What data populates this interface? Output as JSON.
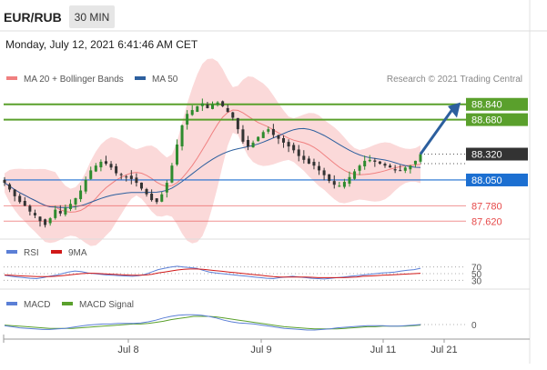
{
  "header": {
    "symbol": "EUR/RUB",
    "timeframe": "30 MIN",
    "datetime": "Monday, July 12, 2021 6:41:46 AM CET",
    "credit": "Research © 2021 Trading Central"
  },
  "colors": {
    "ma20": "#f08080",
    "ma50": "#2c5f9e",
    "bands_fill": "#fbd9d9",
    "resistance": "#5aa02c",
    "pivot": "#1c6fd1",
    "support": "#e64a4a",
    "last_price_bg": "#333333",
    "arrow": "#2c5f9e",
    "rsi": "#5b7fd6",
    "rsi_ma": "#d01818",
    "macd": "#5b7fd6",
    "macd_signal": "#5aa02c",
    "candle_up": "#2e8b2e",
    "candle_down": "#333333"
  },
  "chart_data": [
    {
      "type": "candlestick",
      "legend": [
        {
          "name": "MA 20 + Bollinger Bands",
          "color": "#f08080"
        },
        {
          "name": "MA 50",
          "color": "#2c5f9e"
        }
      ],
      "x_ticks": [
        "Jul 8",
        "Jul 9",
        "Jul 11",
        "Jul 21"
      ],
      "ylim": [
        87.48,
        88.98
      ],
      "levels": [
        {
          "label": "88.840",
          "value": 88.84,
          "kind": "resistance"
        },
        {
          "label": "88.680",
          "value": 88.68,
          "kind": "resistance"
        },
        {
          "label": "88.320",
          "value": 88.32,
          "kind": "last"
        },
        {
          "label": "88.050",
          "value": 88.05,
          "kind": "pivot"
        },
        {
          "label": "87.780",
          "value": 87.78,
          "kind": "support"
        },
        {
          "label": "87.620",
          "value": 87.62,
          "kind": "support"
        }
      ],
      "close": [
        88.02,
        87.95,
        87.88,
        87.82,
        87.78,
        87.72,
        87.68,
        87.62,
        87.58,
        87.65,
        87.74,
        87.7,
        87.76,
        87.8,
        87.86,
        87.94,
        88.05,
        88.15,
        88.2,
        88.24,
        88.22,
        88.18,
        88.12,
        88.1,
        88.08,
        88.06,
        88.02,
        87.96,
        87.9,
        87.84,
        87.82,
        87.9,
        88.02,
        88.2,
        88.42,
        88.62,
        88.74,
        88.78,
        88.82,
        88.85,
        88.8,
        88.84,
        88.86,
        88.82,
        88.76,
        88.7,
        88.58,
        88.45,
        88.4,
        88.44,
        88.5,
        88.55,
        88.58,
        88.52,
        88.48,
        88.44,
        88.4,
        88.36,
        88.3,
        88.26,
        88.22,
        88.2,
        88.15,
        88.1,
        88.04,
        88.0,
        87.99,
        88.03,
        88.08,
        88.14,
        88.2,
        88.25,
        88.26,
        88.24,
        88.22,
        88.2,
        88.18,
        88.15,
        88.15,
        88.18,
        88.2,
        88.25,
        88.32
      ],
      "volatility": 0.06
    },
    {
      "type": "line",
      "name": "RSI",
      "legend": [
        {
          "name": "RSI",
          "color": "#5b7fd6"
        },
        {
          "name": "9MA",
          "color": "#d01818"
        }
      ],
      "y_ticks": [
        "70",
        "50",
        "30"
      ],
      "ylim": [
        20,
        80
      ],
      "rsi": [
        45,
        42,
        40,
        38,
        36,
        35,
        38,
        42,
        45,
        50,
        55,
        58,
        56,
        52,
        50,
        48,
        46,
        45,
        44,
        43,
        42,
        44,
        48,
        55,
        62,
        66,
        70,
        72,
        70,
        68,
        66,
        60,
        55,
        52,
        50,
        48,
        46,
        44,
        42,
        40,
        38,
        36,
        35,
        38,
        40,
        42,
        40,
        38,
        36,
        35,
        34,
        36,
        38,
        40,
        42,
        44,
        46,
        48,
        50,
        52,
        53,
        55,
        58,
        60,
        62,
        66
      ],
      "rsi_ma": [
        46,
        45,
        44,
        43,
        42,
        41,
        41,
        41,
        42,
        44,
        46,
        48,
        50,
        51,
        51,
        50,
        49,
        48,
        47,
        46,
        45,
        45,
        46,
        48,
        52,
        55,
        58,
        61,
        63,
        64,
        64,
        63,
        61,
        59,
        57,
        55,
        53,
        51,
        49,
        47,
        45,
        43,
        41,
        40,
        40,
        40,
        40,
        40,
        39,
        38,
        38,
        38,
        38,
        38,
        39,
        40,
        42,
        43,
        44,
        45,
        46,
        47,
        48,
        49,
        50,
        51
      ]
    },
    {
      "type": "line",
      "name": "MACD",
      "legend": [
        {
          "name": "MACD",
          "color": "#5b7fd6"
        },
        {
          "name": "MACD Signal",
          "color": "#5aa02c"
        }
      ],
      "y_ticks": [
        "0"
      ],
      "ylim": [
        -0.25,
        0.25
      ],
      "macd": [
        -0.02,
        -0.04,
        -0.06,
        -0.07,
        -0.08,
        -0.09,
        -0.09,
        -0.08,
        -0.07,
        -0.05,
        -0.03,
        -0.01,
        0.0,
        0.01,
        0.01,
        0.02,
        0.02,
        0.02,
        0.03,
        0.05,
        0.08,
        0.12,
        0.15,
        0.17,
        0.18,
        0.18,
        0.17,
        0.15,
        0.12,
        0.08,
        0.05,
        0.03,
        0.02,
        0.01,
        -0.01,
        -0.03,
        -0.05,
        -0.07,
        -0.08,
        -0.09,
        -0.1,
        -0.1,
        -0.09,
        -0.08,
        -0.06,
        -0.05,
        -0.04,
        -0.03,
        -0.02,
        -0.02,
        -0.02,
        -0.03,
        -0.03,
        -0.02,
        -0.01,
        0.0
      ],
      "signal": [
        -0.01,
        -0.02,
        -0.03,
        -0.04,
        -0.05,
        -0.06,
        -0.07,
        -0.07,
        -0.07,
        -0.07,
        -0.06,
        -0.05,
        -0.04,
        -0.03,
        -0.02,
        -0.01,
        0.0,
        0.01,
        0.01,
        0.02,
        0.04,
        0.06,
        0.09,
        0.11,
        0.13,
        0.15,
        0.15,
        0.15,
        0.14,
        0.12,
        0.1,
        0.08,
        0.06,
        0.04,
        0.02,
        0.0,
        -0.02,
        -0.04,
        -0.05,
        -0.06,
        -0.07,
        -0.08,
        -0.08,
        -0.08,
        -0.08,
        -0.07,
        -0.06,
        -0.05,
        -0.04,
        -0.04,
        -0.03,
        -0.03,
        -0.03,
        -0.03,
        -0.02,
        -0.01
      ]
    }
  ]
}
